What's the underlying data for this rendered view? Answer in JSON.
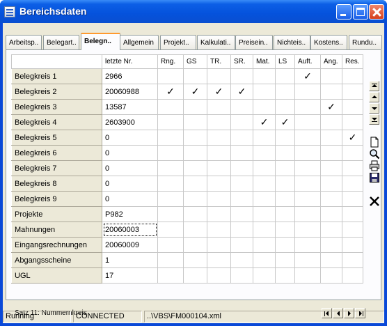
{
  "window": {
    "title": "Bereichsdaten"
  },
  "tabs": [
    "Arbeitsp..",
    "Belegart..",
    "Belegn..",
    "Allgemein",
    "Projekt..",
    "Kalkulati..",
    "Preisein..",
    "Nichteis..",
    "Kostens..",
    "Rundu.."
  ],
  "active_tab": "Belegn..",
  "grid": {
    "columns": [
      "letzte Nr.",
      "Rng.",
      "GS",
      "TR.",
      "SR.",
      "Mat.",
      "LS",
      "Auft.",
      "Ang.",
      "Res."
    ],
    "check_mark": "✓",
    "rows": [
      {
        "label": "Belegkreis 1",
        "nr": "2966",
        "checks": [
          false,
          false,
          false,
          false,
          false,
          false,
          true,
          false,
          false
        ]
      },
      {
        "label": "Belegkreis 2",
        "nr": "20060988",
        "checks": [
          true,
          true,
          true,
          true,
          false,
          false,
          false,
          false,
          false
        ]
      },
      {
        "label": "Belegkreis 3",
        "nr": "13587",
        "checks": [
          false,
          false,
          false,
          false,
          false,
          false,
          false,
          true,
          false
        ]
      },
      {
        "label": "Belegkreis 4",
        "nr": "2603900",
        "checks": [
          false,
          false,
          false,
          false,
          true,
          true,
          false,
          false,
          false
        ]
      },
      {
        "label": "Belegkreis 5",
        "nr": "0",
        "checks": [
          false,
          false,
          false,
          false,
          false,
          false,
          false,
          false,
          true
        ]
      },
      {
        "label": "Belegkreis 6",
        "nr": "0",
        "checks": [
          false,
          false,
          false,
          false,
          false,
          false,
          false,
          false,
          false
        ]
      },
      {
        "label": "Belegkreis 7",
        "nr": "0",
        "checks": [
          false,
          false,
          false,
          false,
          false,
          false,
          false,
          false,
          false
        ]
      },
      {
        "label": "Belegkreis 8",
        "nr": "0",
        "checks": [
          false,
          false,
          false,
          false,
          false,
          false,
          false,
          false,
          false
        ]
      },
      {
        "label": "Belegkreis 9",
        "nr": "0",
        "checks": [
          false,
          false,
          false,
          false,
          false,
          false,
          false,
          false,
          false
        ]
      },
      {
        "label": "Projekte",
        "nr": "P982",
        "checks": [
          false,
          false,
          false,
          false,
          false,
          false,
          false,
          false,
          false
        ]
      },
      {
        "label": "Mahnungen",
        "nr": "20060003",
        "checks": [
          false,
          false,
          false,
          false,
          false,
          false,
          false,
          false,
          false
        ]
      },
      {
        "label": "Eingangsrechnungen",
        "nr": "20060009",
        "checks": [
          false,
          false,
          false,
          false,
          false,
          false,
          false,
          false,
          false
        ]
      },
      {
        "label": "Abgangsscheine",
        "nr": "1",
        "checks": [
          false,
          false,
          false,
          false,
          false,
          false,
          false,
          false,
          false
        ]
      },
      {
        "label": "UGL",
        "nr": "17",
        "checks": [
          false,
          false,
          false,
          false,
          false,
          false,
          false,
          false,
          false
        ]
      }
    ]
  },
  "record_status": "Satz 11: Nummernkreis",
  "statusbar": {
    "state": "Running",
    "connection": "CONNECTED",
    "file": "..\\VBS\\FM000104.xml"
  },
  "colors": {
    "titlebar": "#0552dc",
    "window_bg": "#ece9d8",
    "active_tab_accent": "#ff9a2e",
    "close_button": "#d6401c"
  },
  "icons": [
    "new-document-icon",
    "find-icon",
    "print-icon",
    "save-icon",
    "delete-icon"
  ]
}
